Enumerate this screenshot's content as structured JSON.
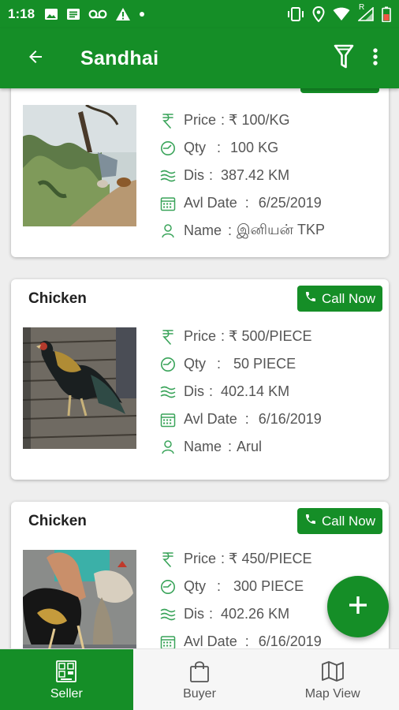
{
  "status_bar": {
    "time": "1:18",
    "left_icons": [
      "image-icon",
      "message-icon",
      "voicemail-icon",
      "warning-icon",
      "dot-icon"
    ],
    "right_icons": [
      "vibrate-icon",
      "location-icon",
      "wifi-icon",
      "signal-icon",
      "battery-icon"
    ],
    "roaming_mark": "R"
  },
  "app_bar": {
    "title": "Sandhai",
    "back_icon": "arrow-back-icon",
    "filter_icon": "filter-icon",
    "more_icon": "more-vert-icon"
  },
  "listings": [
    {
      "title": "",
      "call_label": "",
      "price_label": "Price",
      "price_value": "₹ 100/KG",
      "qty_label": "Qty",
      "qty_value": "100 KG",
      "dis_label": "Dis",
      "dis_value": "387.42 KM",
      "date_label": "Avl Date",
      "date_value": "6/25/2019",
      "name_label": "Name",
      "name_value": "இனியன் TKP"
    },
    {
      "title": "Chicken",
      "call_label": "Call Now",
      "price_label": "Price",
      "price_value": "₹ 500/PIECE",
      "qty_label": "Qty",
      "qty_value": "50 PIECE",
      "dis_label": "Dis",
      "dis_value": "402.14 KM",
      "date_label": "Avl Date",
      "date_value": "6/16/2019",
      "name_label": "Name",
      "name_value": "Arul"
    },
    {
      "title": "Chicken",
      "call_label": "Call Now",
      "price_label": "Price",
      "price_value": "₹ 450/PIECE",
      "qty_label": "Qty",
      "qty_value": "300 PIECE",
      "dis_label": "Dis",
      "dis_value": "402.26 KM",
      "date_label": "Avl Date",
      "date_value": "6/16/2019",
      "name_label": "",
      "name_value": ""
    }
  ],
  "fab": {
    "icon": "add-icon"
  },
  "bottom_nav": {
    "items": [
      {
        "label": "Seller",
        "icon": "seller-icon",
        "active": true
      },
      {
        "label": "Buyer",
        "icon": "shopping-bag-icon",
        "active": false
      },
      {
        "label": "Map View",
        "icon": "map-icon",
        "active": false
      }
    ]
  },
  "colors": {
    "primary": "#158e27",
    "text_dark": "#212121",
    "text_body": "#555555",
    "background": "#eeeeee"
  }
}
